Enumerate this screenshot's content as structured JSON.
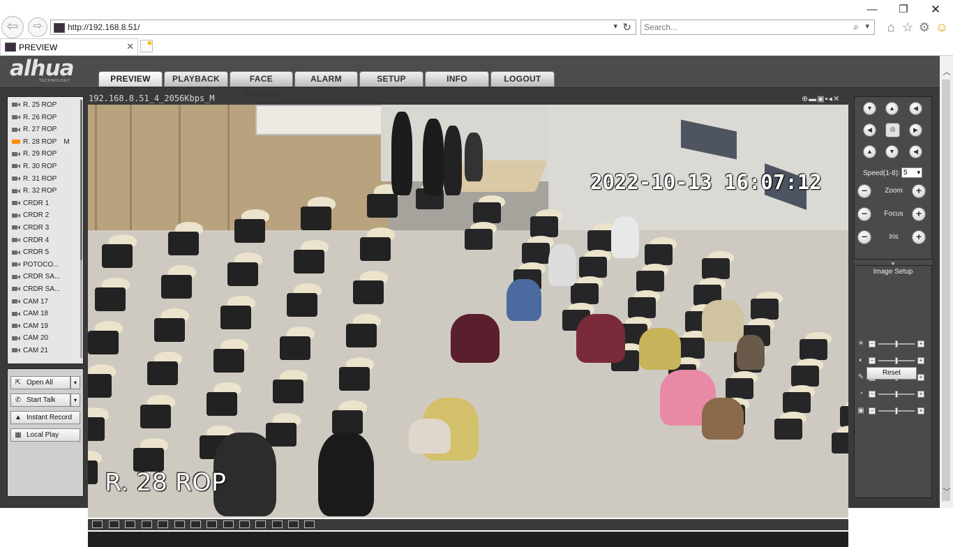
{
  "browser": {
    "url": "http://192.168.8.51/",
    "search_placeholder": "Search...",
    "tab_title": "PREVIEW",
    "icons": [
      "back-icon",
      "forward-icon",
      "refresh-icon",
      "search-icon",
      "home-icon",
      "star-icon",
      "gear-icon",
      "smiley-icon",
      "minimize-icon",
      "restore-icon",
      "close-icon"
    ]
  },
  "app": {
    "logo_text": "alhua",
    "logo_tagline": "TECHNOLOGY",
    "nav_tabs": [
      "PREVIEW",
      "PLAYBACK",
      "FACE SEARCH",
      "ALARM",
      "SETUP",
      "INFO",
      "LOGOUT"
    ],
    "active_tab": "PREVIEW"
  },
  "channels": {
    "items": [
      {
        "label": "R. 25 ROP",
        "flag": ""
      },
      {
        "label": "R. 26 ROP",
        "flag": ""
      },
      {
        "label": "R. 27 ROP",
        "flag": ""
      },
      {
        "label": "R. 28 ROP",
        "flag": "M"
      },
      {
        "label": "R. 29 ROP",
        "flag": ""
      },
      {
        "label": "R. 30 ROP",
        "flag": ""
      },
      {
        "label": "R. 31 ROP",
        "flag": ""
      },
      {
        "label": "R. 32 ROP",
        "flag": ""
      },
      {
        "label": "CRDR 1",
        "flag": ""
      },
      {
        "label": "CRDR 2",
        "flag": ""
      },
      {
        "label": "CRDR 3",
        "flag": ""
      },
      {
        "label": "CRDR 4",
        "flag": ""
      },
      {
        "label": "CRDR 5",
        "flag": ""
      },
      {
        "label": "POTOCO...",
        "flag": ""
      },
      {
        "label": "CRDR SA...",
        "flag": ""
      },
      {
        "label": "CRDR SA...",
        "flag": ""
      },
      {
        "label": "CAM 17",
        "flag": ""
      },
      {
        "label": "CAM 18",
        "flag": ""
      },
      {
        "label": "CAM 19",
        "flag": ""
      },
      {
        "label": "CAM 20",
        "flag": ""
      },
      {
        "label": "CAM 21",
        "flag": ""
      }
    ],
    "active_index": 3,
    "active_color": "#ff8a00"
  },
  "controls": {
    "open_all": "Open All",
    "start_talk": "Start Talk",
    "instant_record": "Instant Record",
    "local_play": "Local Play"
  },
  "video": {
    "stream_title": "192.168.8.51_4_2056Kbps_M",
    "osd_timestamp": "2022-10-13 16:07:12",
    "osd_channel_name": "R. 28 ROP",
    "window_icons": [
      "zoom-icon",
      "stream-icon",
      "snapshot-icon",
      "record-icon",
      "audio-icon",
      "close-icon"
    ]
  },
  "layouts": [
    "1x1 full",
    "2x2",
    "fit",
    "wide",
    "1",
    "4",
    "6",
    "8",
    "9",
    "13",
    "16",
    "20",
    "25",
    "36"
  ],
  "ptz": {
    "speed_label": "Speed(1-8):",
    "speed_value": "5",
    "zoom_label": "Zoom",
    "focus_label": "Focus",
    "iris_label": "Iris"
  },
  "image_setup": {
    "title": "Image Setup",
    "sliders": [
      {
        "name": "brightness",
        "value": 0.5
      },
      {
        "name": "contrast",
        "value": 0.5
      },
      {
        "name": "saturation",
        "value": 0.5
      },
      {
        "name": "hue",
        "value": 0.5
      },
      {
        "name": "gain",
        "value": 0.5
      }
    ],
    "reset": "Reset"
  }
}
